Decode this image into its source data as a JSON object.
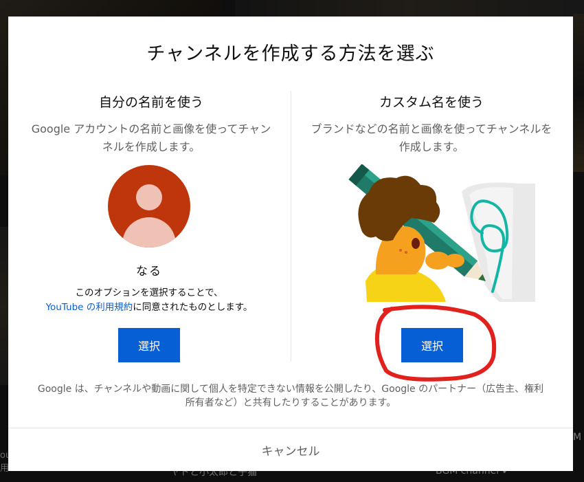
{
  "dialog": {
    "title": "チャンネルを作成する方法を選ぶ",
    "left_option": {
      "title": "自分の名前を使う",
      "description": "Google アカウントの名前と画像を使ってチャンネルを作成します。",
      "name": "なる",
      "consent_prefix": "このオプションを選択することで、",
      "consent_link": "YouTube の利用規約",
      "consent_suffix": "に同意されたものとします。",
      "button_label": "選択"
    },
    "right_option": {
      "title": "カスタム名を使う",
      "description": "ブランドなどの名前と画像を使ってチャンネルを作成します。",
      "button_label": "選択"
    },
    "footer_note": "Google は、チャンネルや動画に関して個人を特定できない情報を公開したり、Google のパートナー（広告主、権利所有者など）と共有したりすることがあります。",
    "cancel_label": "キャンセル"
  },
  "background": {
    "bottom_mid_text": "ヤドと小太郎と子猫",
    "bottom_right_text": "BGM channel ✔",
    "bottom_left_text": "ou 用",
    "right_edge_text": "M"
  },
  "colors": {
    "primary_button": "#065fd4",
    "link": "#065fd4",
    "avatar_bg": "#bf360c",
    "annotation": "#e0211e"
  },
  "icons": {
    "avatar": "default-user-avatar-icon",
    "illustration": "person-with-pencil-illustration"
  }
}
